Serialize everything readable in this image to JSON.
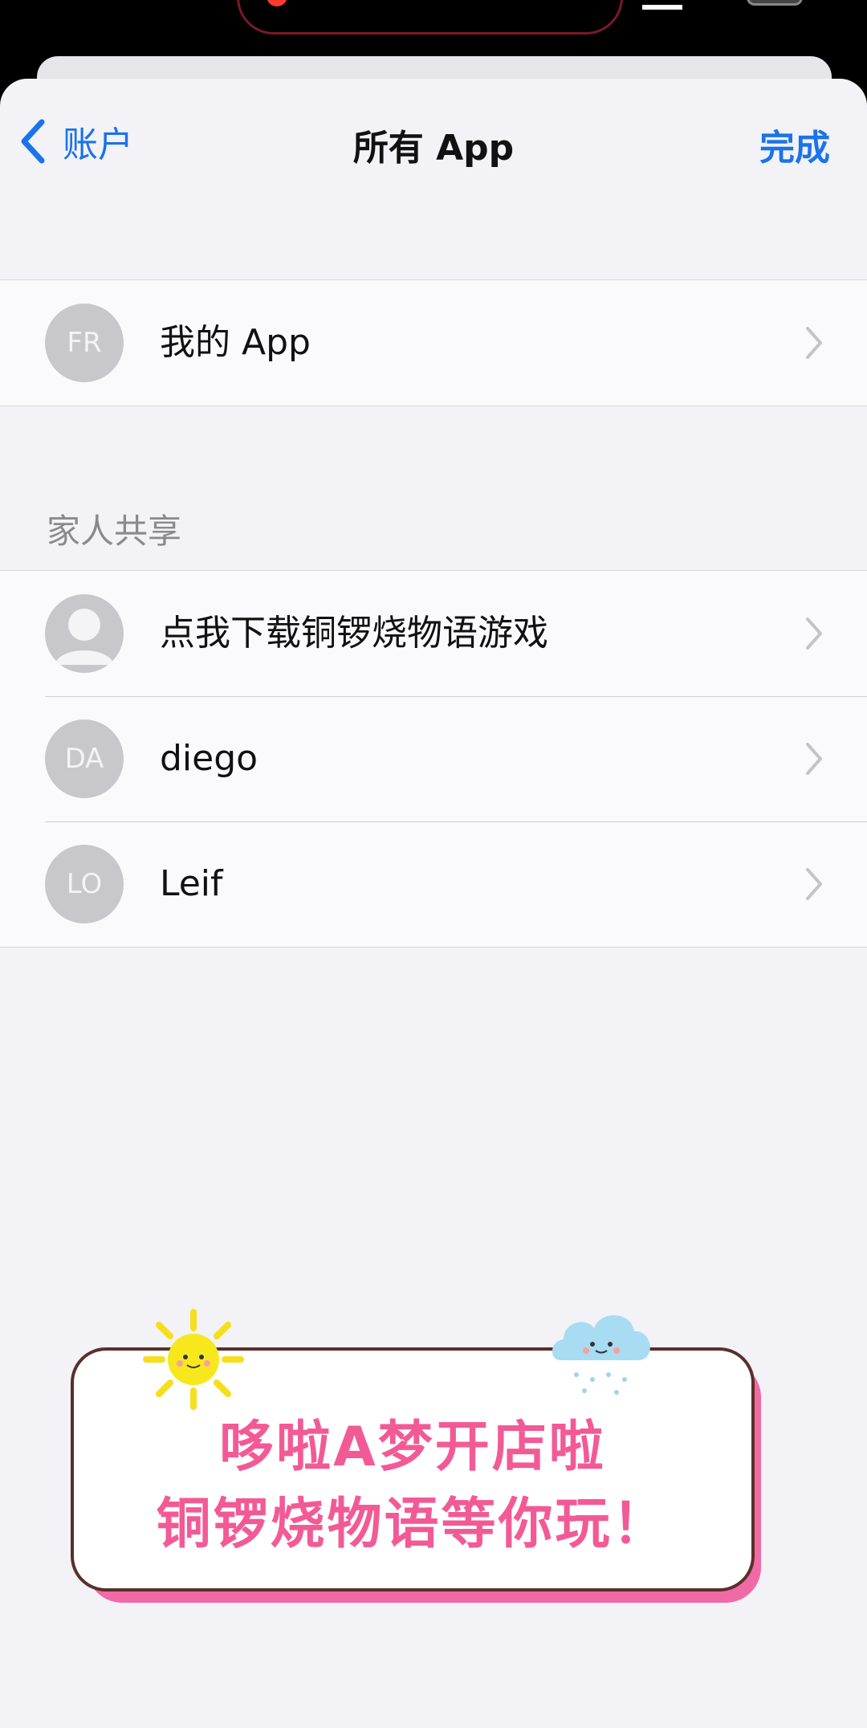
{
  "nav": {
    "back_label": "账户",
    "title": "所有 App",
    "done_label": "完成"
  },
  "my_apps": {
    "avatar_initials": "FR",
    "label": "我的 App"
  },
  "family_section": {
    "header": "家人共享",
    "members": [
      {
        "initials": "",
        "label": "点我下载铜锣烧物语游戏",
        "avatar": "person-placeholder-icon"
      },
      {
        "initials": "DA",
        "label": "diego"
      },
      {
        "initials": "LO",
        "label": "Leif"
      }
    ]
  },
  "banner": {
    "line1": "哆啦A梦开店啦",
    "line2": "铜锣烧物语等你玩！",
    "text_color": "#f25a96",
    "shadow_color": "#f06aa6"
  },
  "colors": {
    "accent": "#1a73e8",
    "background": "#f2f2f7",
    "avatar": "#c7c7cc"
  }
}
